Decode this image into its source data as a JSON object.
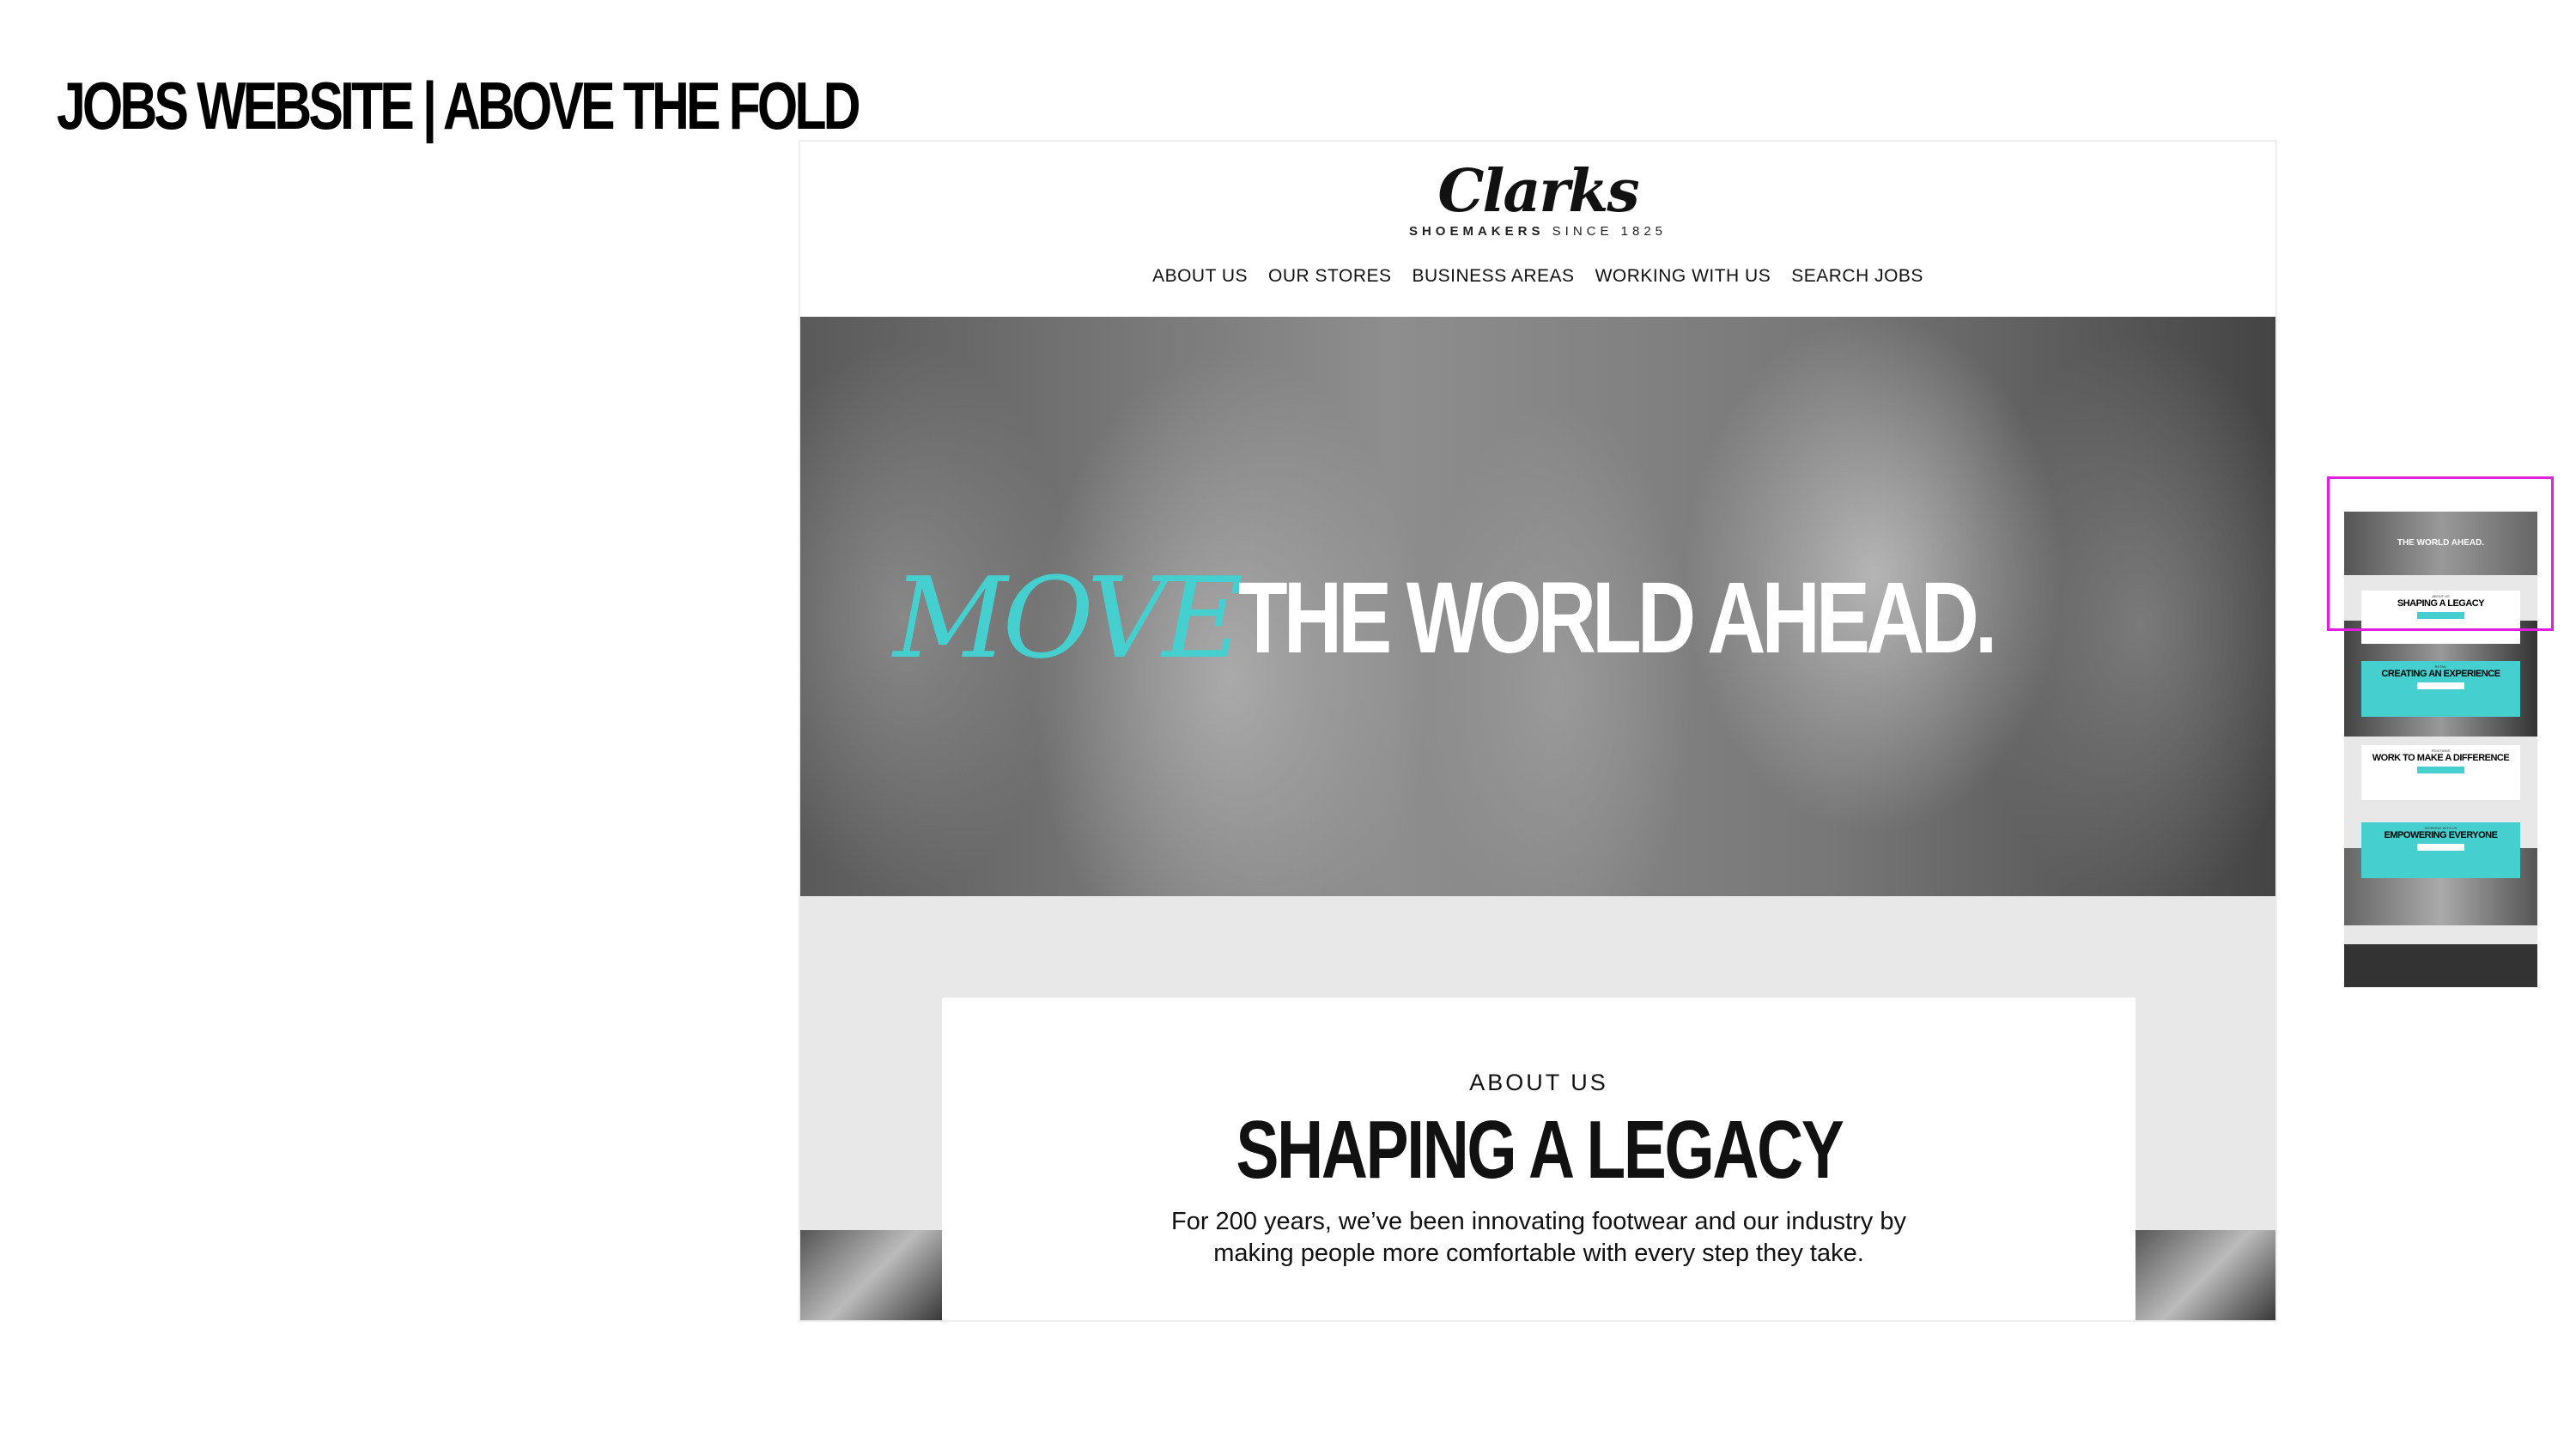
{
  "slide": {
    "title": "JOBS WEBSITE | ABOVE THE FOLD"
  },
  "header": {
    "logo": "Clarks",
    "tagline_bold": "SHOEMAKERS",
    "tagline_rest": "SINCE 1825",
    "nav": [
      "ABOUT US",
      "OUR STORES",
      "BUSINESS AREAS",
      "WORKING WITH US",
      "SEARCH JOBS"
    ]
  },
  "hero": {
    "script_word": "MOVE",
    "headline": "THE WORLD AHEAD."
  },
  "about": {
    "label": "ABOUT US",
    "title": "SHAPING A LEGACY",
    "body": "For 200 years, we’ve been innovating footwear and our industry by making people more comfortable with every step they take."
  },
  "thumbnail": {
    "hero": "THE WORLD AHEAD.",
    "sections": [
      {
        "label": "ABOUT US",
        "title": "SHAPING A LEGACY"
      },
      {
        "label": "RETAIL",
        "title": "CREATING AN EXPERIENCE"
      },
      {
        "label": "POSITIONS",
        "title": "WORK TO MAKE A DIFFERENCE"
      },
      {
        "label": "WORKING WITH US",
        "title": "EMPOWERING EVERYONE"
      }
    ]
  },
  "colors": {
    "accent": "#45cfcf",
    "highlight": "#e020e0",
    "footer": "#333333"
  }
}
